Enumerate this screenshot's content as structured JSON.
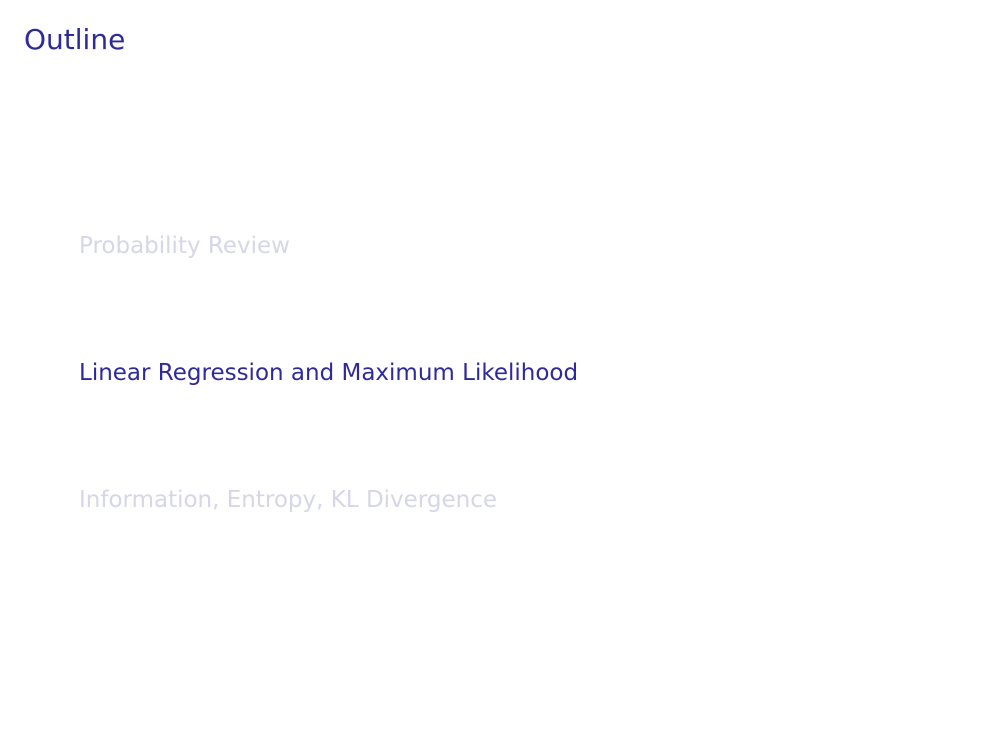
{
  "slide": {
    "title": "Outline",
    "items": [
      {
        "label": "Probability Review",
        "state": "dimmed"
      },
      {
        "label": "Linear Regression and Maximum Likelihood",
        "state": "current"
      },
      {
        "label": "Information, Entropy, KL Divergence",
        "state": "dimmed"
      }
    ]
  },
  "colors": {
    "accent": "#2f2a9b",
    "dimmed": "#d6d6e8",
    "background": "#ffffff"
  }
}
